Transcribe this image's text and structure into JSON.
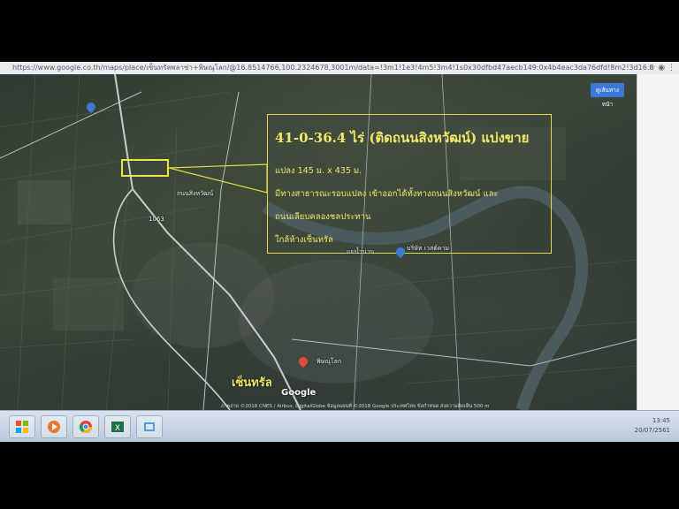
{
  "browser": {
    "url": "https://www.google.co.th/maps/place/เซ็นทรัลพลาซ่า+พิษณุโลก/@16.8514766,100.2324678,3001m/data=!3m1!1e3!4m5!3m4!1s0x30dfbd47aecb149:0x4b4eac3da76dfd!8m2!3d16.8"
  },
  "annotation": {
    "headline": "41-0-36.4 ไร่ (ติดถนนสิงหวัฒน์) แบ่งขาย",
    "line1": "แปลง 145 ม. x 435 ม.",
    "line2": "มีทางสาธารณะรอบแปลง เข้าออกได้ทั้งทางถนนสิงหวัฒน์ และ",
    "line3": "ถนนเลียบคลองชลประทาน",
    "line4": "ใกล้ห้างเซ็นทรัล",
    "accent": "#f0e34a"
  },
  "map": {
    "place_label": "เซ็นทรัล",
    "google_label": "Google",
    "road_label_1": "1063",
    "road_label_2": "ถนนสิงหวัฒน์",
    "river_label": "แม่น้ำน่าน",
    "poi_label": "บริษัท เวสต์คาม",
    "district_label": "พิษณุโลก",
    "maps_button": "ดูเส้นทางหนัา",
    "footer": "ภาพถ่าย ©2018 CNES / Airbus, DigitalGlobe ข้อมูลแผนที่ ©2018 Google   ประเทศไทย   ข้อกำหนด   ส่งความคิดเห็น   500 m"
  },
  "taskbar": {
    "time": "13:45",
    "date": "20/07/2561",
    "icons": [
      "start-icon",
      "media-player-icon",
      "chrome-icon",
      "excel-icon",
      "app-icon"
    ]
  }
}
